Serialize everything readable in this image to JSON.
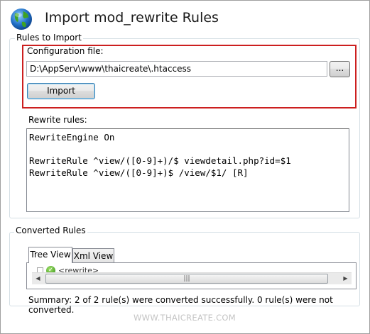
{
  "dialog": {
    "title": "Import mod_rewrite Rules",
    "app_icon": "globe-icon"
  },
  "rules_to_import": {
    "group_label": "Rules to Import",
    "config_label": "Configuration file:",
    "config_value": "D:\\AppServ\\www\\thaicreate\\.htaccess",
    "browse_label": "...",
    "import_label": "Import",
    "rewrite_label": "Rewrite rules:",
    "rewrite_text": "RewriteEngine On\n\nRewriteRule ^view/([0-9]+)/$ viewdetail.php?id=$1\nRewriteRule ^view/([0-9]+)$ /view/$1/ [R]"
  },
  "converted": {
    "group_label": "Converted Rules",
    "tabs": [
      "Tree View",
      "Xml View"
    ],
    "tree_node": "<rewrite>",
    "summary": "Summary: 2 of 2 rule(s) were converted successfully. 0 rule(s) were not converted."
  },
  "watermark": "WWW.THAICREATE.COM",
  "colors": {
    "highlight_border": "#cc1f1f",
    "group_border": "#d5dfe5"
  }
}
